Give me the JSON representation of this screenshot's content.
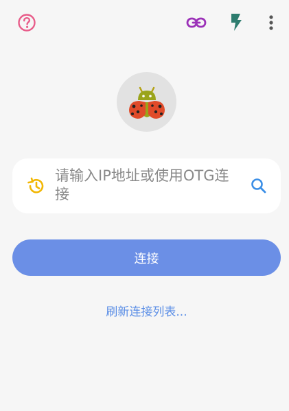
{
  "toolbar": {
    "help_icon": "help-circle-icon",
    "link_icon": "link-icon",
    "flash_icon": "flash-icon",
    "more_icon": "more-vertical-icon"
  },
  "logo": {
    "icon": "ladybug-android-icon"
  },
  "connection": {
    "input_placeholder": "请输入IP地址或使用OTG连接",
    "history_icon": "history-icon",
    "search_icon": "search-icon"
  },
  "actions": {
    "connect_label": "连接",
    "refresh_label": "刷新连接列表..."
  },
  "colors": {
    "background": "#f6f6f6",
    "help": "#e85d8a",
    "link": "#9b30b8",
    "flash": "#2e7d6f",
    "accent_button": "#6b8fe6",
    "link_text": "#5b8ee6",
    "history": "#f2b705",
    "search": "#3a8ee6"
  }
}
